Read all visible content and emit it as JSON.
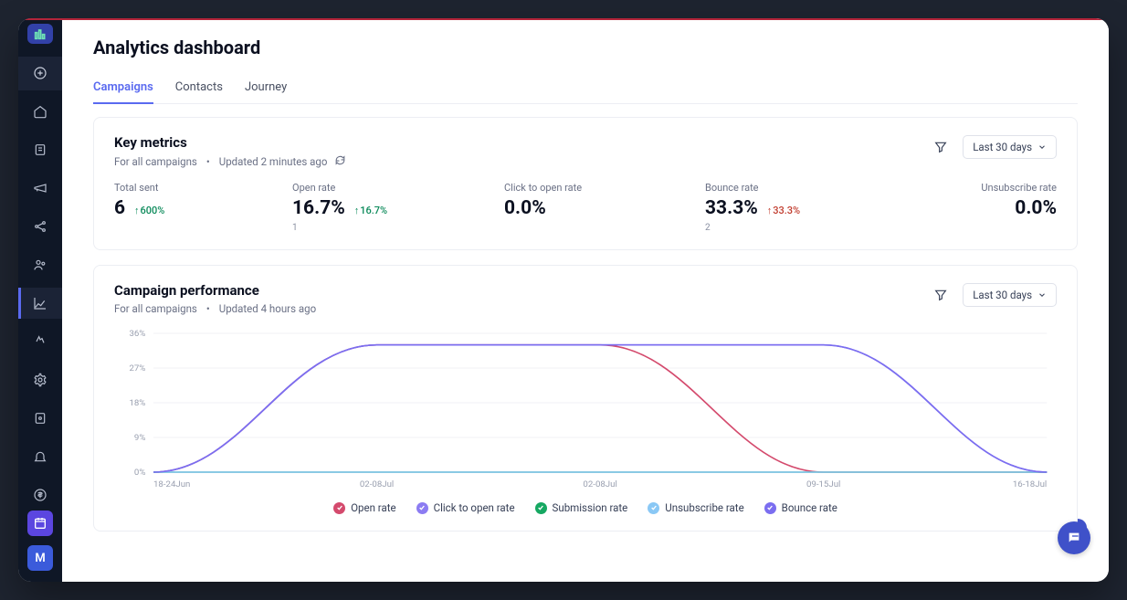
{
  "page": {
    "title": "Analytics dashboard"
  },
  "tabs": [
    {
      "label": "Campaigns",
      "active": true
    },
    {
      "label": "Contacts",
      "active": false
    },
    {
      "label": "Journey",
      "active": false
    }
  ],
  "key_metrics": {
    "title": "Key metrics",
    "sub_scope": "For all campaigns",
    "sub_updated": "Updated 2 minutes ago",
    "date_label": "Last 30 days",
    "items": [
      {
        "label": "Total sent",
        "value": "6",
        "delta": "600%",
        "delta_dir": "up",
        "small": ""
      },
      {
        "label": "Open rate",
        "value": "16.7%",
        "delta": "16.7%",
        "delta_dir": "up",
        "small": "1"
      },
      {
        "label": "Click to open rate",
        "value": "0.0%",
        "delta": "",
        "delta_dir": "",
        "small": ""
      },
      {
        "label": "Bounce rate",
        "value": "33.3%",
        "delta": "33.3%",
        "delta_dir": "down",
        "small": "2"
      },
      {
        "label": "Unsubscribe rate",
        "value": "0.0%",
        "delta": "",
        "delta_dir": "",
        "small": ""
      }
    ]
  },
  "performance": {
    "title": "Campaign performance",
    "sub_scope": "For all campaigns",
    "sub_updated": "Updated 4 hours ago",
    "date_label": "Last 30 days",
    "legend": [
      {
        "label": "Open rate",
        "color": "#d44a6d"
      },
      {
        "label": "Click to open rate",
        "color": "#8c7cf2"
      },
      {
        "label": "Submission rate",
        "color": "#16a862"
      },
      {
        "label": "Unsubscribe rate",
        "color": "#8ac8f5"
      },
      {
        "label": "Bounce rate",
        "color": "#7b6ef0"
      }
    ]
  },
  "chart_data": {
    "type": "line",
    "categories": [
      "18-24Jun",
      "02-08Jul",
      "02-08Jul",
      "09-15Jul",
      "16-18Jul"
    ],
    "ylabel": "",
    "xlabel": "",
    "ylim": [
      0,
      36
    ],
    "yticks": [
      "0%",
      "9%",
      "18%",
      "27%",
      "36%"
    ],
    "series": [
      {
        "name": "Open rate",
        "color": "#d44a6d",
        "values": [
          0,
          33,
          33,
          0,
          0
        ]
      },
      {
        "name": "Click to open rate",
        "color": "#8c7cf2",
        "values": [
          0,
          33,
          33,
          33,
          0
        ]
      },
      {
        "name": "Submission rate",
        "color": "#16a862",
        "values": [
          0,
          0,
          0,
          0,
          0
        ]
      },
      {
        "name": "Unsubscribe rate",
        "color": "#8ac8f5",
        "values": [
          0,
          0,
          0,
          0,
          0
        ]
      },
      {
        "name": "Bounce rate",
        "color": "#7b6ef0",
        "values": [
          0,
          33,
          33,
          33,
          0
        ]
      }
    ]
  },
  "user_initial": "M"
}
